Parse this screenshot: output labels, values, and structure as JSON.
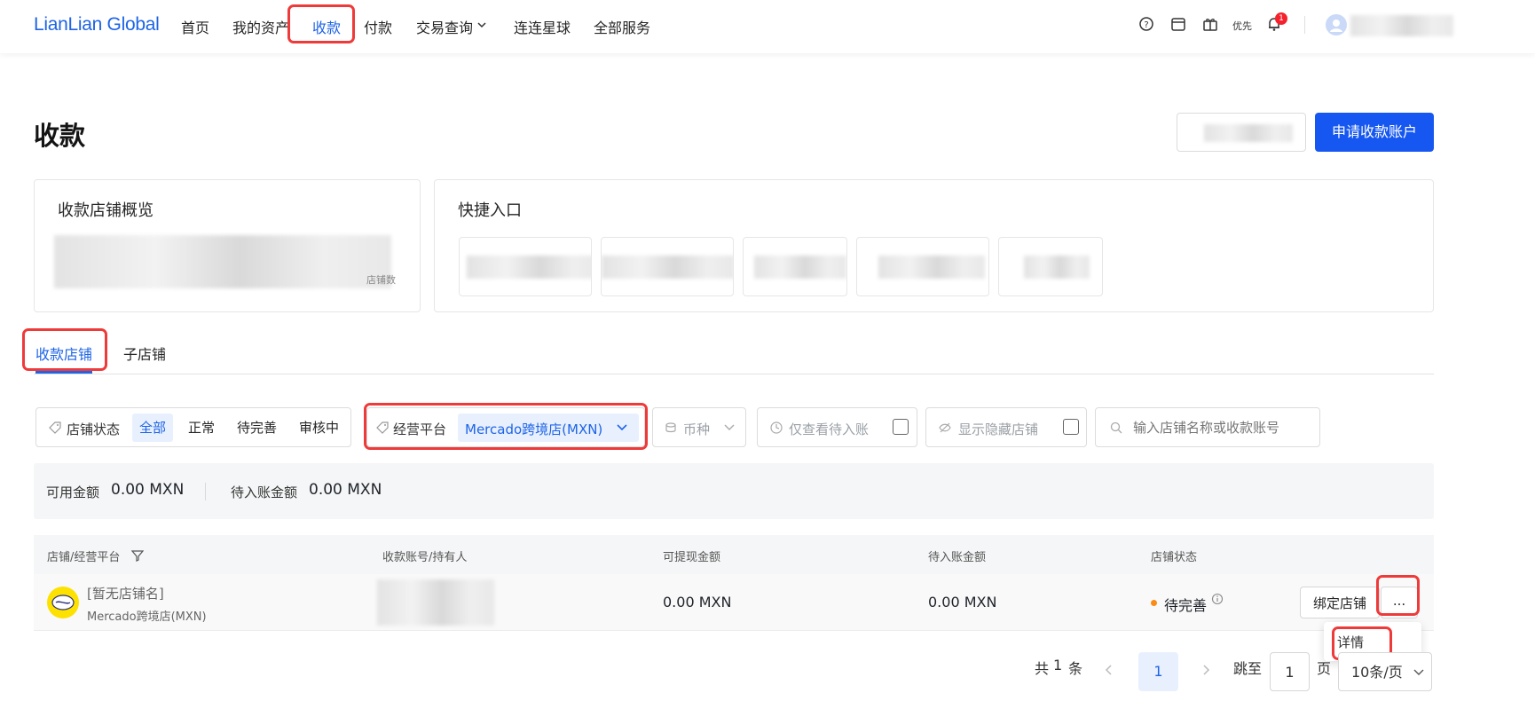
{
  "header": {
    "logo": "LianLian Global",
    "nav": [
      {
        "label": "首页"
      },
      {
        "label": "我的资产"
      },
      {
        "label": "收款"
      },
      {
        "label": "付款"
      },
      {
        "label": "交易查询"
      },
      {
        "label": "连连星球"
      },
      {
        "label": "全部服务"
      }
    ],
    "right_label": "优先",
    "notification_count": "1"
  },
  "page": {
    "title": "收款",
    "apply_button": "申请收款账户"
  },
  "overview_card": {
    "title": "收款店铺概览",
    "footnote": "店铺数"
  },
  "quick_card": {
    "title": "快捷入口"
  },
  "tabs": [
    {
      "label": "收款店铺"
    },
    {
      "label": "子店铺"
    }
  ],
  "filters": {
    "status_label": "店铺状态",
    "status_options": [
      "全部",
      "正常",
      "待完善",
      "审核中"
    ],
    "platform_label": "经营平台",
    "platform_value": "Mercado跨境店(MXN)",
    "currency_label": "币种",
    "pending_only_label": "仅查看待入账",
    "show_hidden_label": "显示隐藏店铺",
    "search_placeholder": "输入店铺名称或收款账号"
  },
  "summary": {
    "available_label": "可用金额",
    "available_value": "0.00 MXN",
    "pending_label": "待入账金额",
    "pending_value": "0.00 MXN"
  },
  "table": {
    "headers": [
      "店铺/经营平台",
      "收款账号/持有人",
      "可提现金额",
      "待入账金额",
      "店铺状态"
    ],
    "rows": [
      {
        "store_name": "[暂无店铺名]",
        "platform": "Mercado跨境店(MXN)",
        "withdrawable": "0.00 MXN",
        "pending": "0.00 MXN",
        "status": "待完善",
        "bind_button": "绑定店铺",
        "more_button": "..."
      }
    ],
    "more_menu": [
      "详情"
    ]
  },
  "pagination": {
    "total_prefix": "共",
    "total": "1",
    "total_suffix": "条",
    "current_page": "1",
    "jump_label": "跳至",
    "jump_value": "1",
    "page_suffix": "页",
    "page_size": "10条/页"
  },
  "colors": {
    "accent": "#1e64e6",
    "primary_button": "#1557f0",
    "highlight": "#ef3a3a",
    "status_dot": "#fa8c16"
  }
}
